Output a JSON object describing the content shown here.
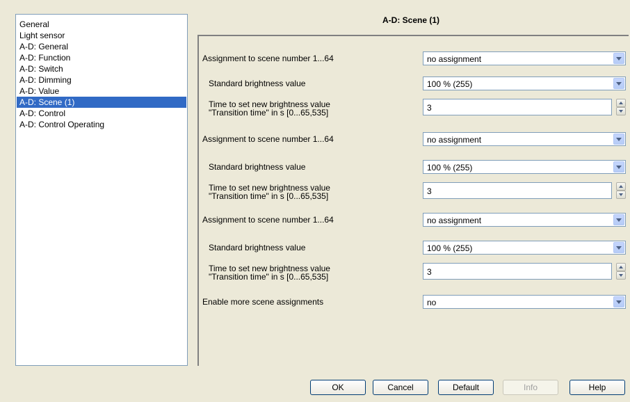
{
  "nav": {
    "items": [
      {
        "label": "General"
      },
      {
        "label": "Light sensor"
      },
      {
        "label": "A-D: General"
      },
      {
        "label": "A-D: Function"
      },
      {
        "label": "A-D: Switch"
      },
      {
        "label": "A-D: Dimming"
      },
      {
        "label": "A-D: Value"
      },
      {
        "label": "A-D: Scene (1)",
        "selected": true
      },
      {
        "label": "A-D: Control"
      },
      {
        "label": "A-D: Control Operating"
      }
    ]
  },
  "page": {
    "title": "A-D: Scene (1)"
  },
  "params": [
    {
      "label": "Assignment to scene number 1...64",
      "value": "no assignment"
    },
    {
      "label": "Standard brightness value",
      "value": "100 % (255)"
    },
    {
      "label_line1": "Time to set new brightness value",
      "label_line2": "\"Transition time\" in s [0...65,535]",
      "value": "3"
    },
    {
      "label": "Assignment to scene number 1...64",
      "value": "no assignment"
    },
    {
      "label": "Standard brightness value",
      "value": "100 % (255)"
    },
    {
      "label_line1": "Time to set new brightness value",
      "label_line2": "\"Transition time\" in s [0...65,535]",
      "value": "3"
    },
    {
      "label": "Assignment to scene number 1...64",
      "value": "no assignment"
    },
    {
      "label": "Standard brightness value",
      "value": "100 % (255)"
    },
    {
      "label_line1": "Time to set new brightness value",
      "label_line2": "\"Transition time\" in s [0...65,535]",
      "value": "3"
    },
    {
      "label": "Enable more scene assignments",
      "value": "no"
    }
  ],
  "buttons": {
    "ok": "OK",
    "cancel": "Cancel",
    "default": "Default",
    "info": "Info",
    "help": "Help"
  }
}
